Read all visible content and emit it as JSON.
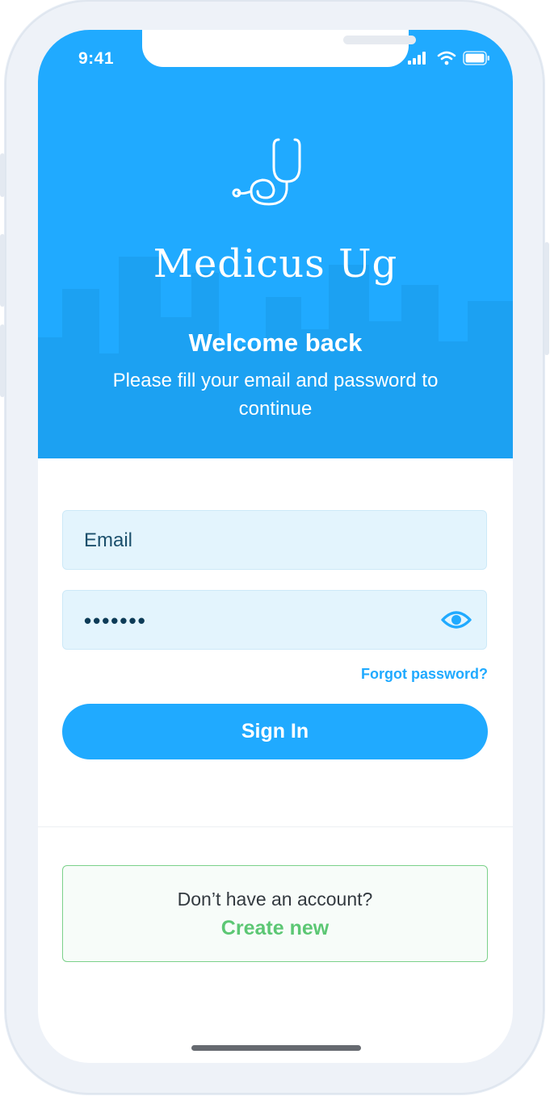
{
  "status_bar": {
    "time": "9:41",
    "icons": [
      "cellular-signal-icon",
      "wifi-icon",
      "battery-icon"
    ]
  },
  "header": {
    "logo_icon": "stethoscope-icon",
    "brand_name": "Medicus Ug",
    "title": "Welcome back",
    "subtitle": "Please fill your email and password to continue"
  },
  "form": {
    "email_placeholder": "Email",
    "password_value": "•••••••",
    "password_toggle_icon": "eye-icon",
    "forgot_password": "Forgot password?",
    "sign_in_label": "Sign In"
  },
  "signup": {
    "question": "Don’t have an account?",
    "link": "Create new"
  },
  "colors": {
    "primary": "#20aaff",
    "input_bg": "#e3f4fd",
    "success": "#5cc774",
    "background": "#ffffff"
  }
}
